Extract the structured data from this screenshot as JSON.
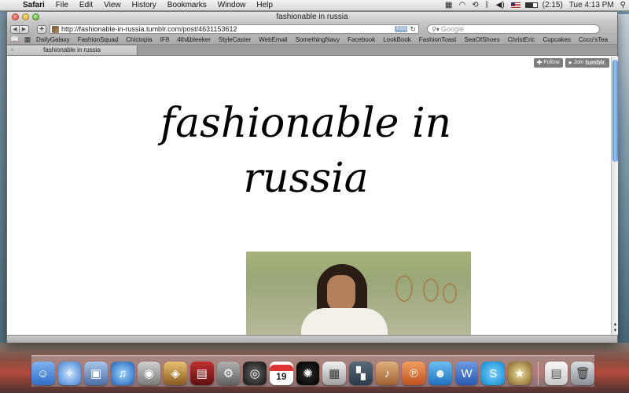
{
  "menubar": {
    "app": "Safari",
    "items": [
      "File",
      "Edit",
      "View",
      "History",
      "Bookmarks",
      "Window",
      "Help"
    ],
    "battery": "(2:15)",
    "clock": "Tue 4:13 PM"
  },
  "window": {
    "title": "fashionable in russia"
  },
  "toolbar": {
    "back": "◀",
    "forward": "▶",
    "add": "+",
    "url": "http://fashionable-in-russia.tumblr.com/post/4631153612",
    "rss": "RSS",
    "search_placeholder": "Google"
  },
  "bookmarks": [
    "DailyGalaxy",
    "FashionSquad",
    "Chictopia",
    "IF8",
    "4th&bleeker",
    "StyleCaster",
    "WebEmail",
    "SomethingNavy",
    "Facebook",
    "LookBook",
    "FashionToast",
    "SeaOfShoes",
    "ChristEric",
    "Cupcakes",
    "Coco'sTea"
  ],
  "tab": {
    "label": "fashionable in russia"
  },
  "tumblr": {
    "follow": "Follow",
    "join": "Join",
    "brand": "tumblr."
  },
  "blog": {
    "title": "fashionable in russia"
  },
  "dock": {
    "calendar_day": "19"
  },
  "colors": {
    "scroll_thumb": "#5d8ed8",
    "tumblr_button": "#7d7d7d"
  }
}
